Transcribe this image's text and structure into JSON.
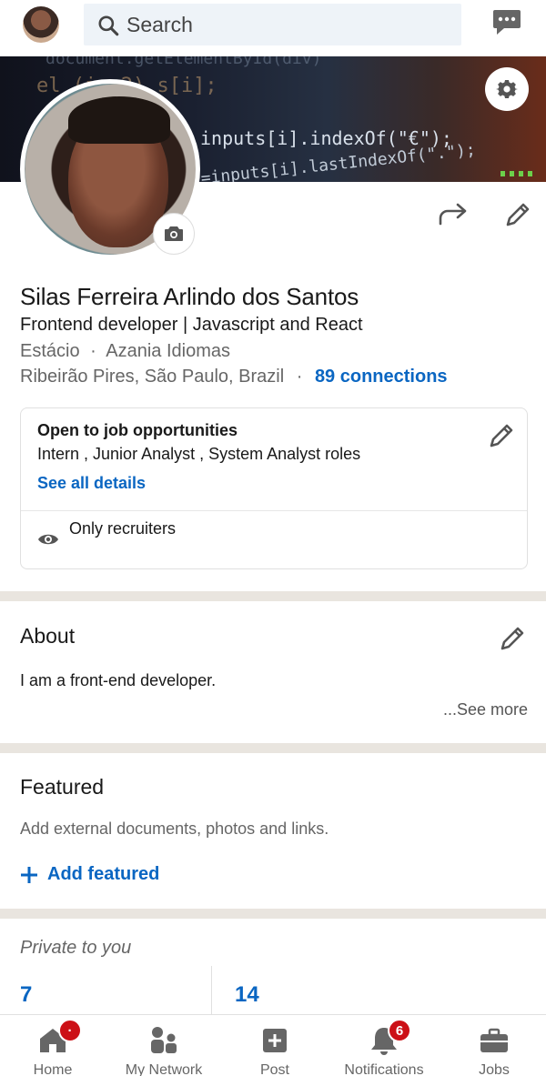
{
  "search": {
    "placeholder": "Search"
  },
  "banner": {
    "code_line_0": "document.getElementById(div)",
    "code_line_1": "el  (i==2)  s[i];",
    "code_line_2": "inputs[i].indexOf(\"€\");",
    "code_line_3": "=inputs[i].lastIndexOf(\".\");"
  },
  "profile": {
    "name": "Silas Ferreira Arlindo dos Santos",
    "headline": "Frontend developer | Javascript and React",
    "school": "Estácio",
    "company": "Azania Idiomas",
    "location": "Ribeirão Pires, São Paulo, Brazil",
    "connections": "89 connections",
    "separator": "·"
  },
  "open_to_work": {
    "title": "Open to job opportunities",
    "roles": "Intern , Junior Analyst , System Analyst roles",
    "link": "See all details",
    "visibility": "Only recruiters"
  },
  "about": {
    "title": "About",
    "text": "I am a front-end developer.",
    "see_more": "...See more"
  },
  "featured": {
    "title": "Featured",
    "description": "Add external documents, photos and links.",
    "add_label": "Add featured"
  },
  "private": {
    "title": "Private to you",
    "stat_1": "7",
    "stat_2": "14"
  },
  "bottom_nav": {
    "home": "Home",
    "network": "My Network",
    "post": "Post",
    "notifications": "Notifications",
    "jobs": "Jobs",
    "home_badge": "·",
    "notifications_badge": "6"
  },
  "colors": {
    "accent": "#0a66c2",
    "badge": "#cc1016",
    "icon": "#666666"
  }
}
